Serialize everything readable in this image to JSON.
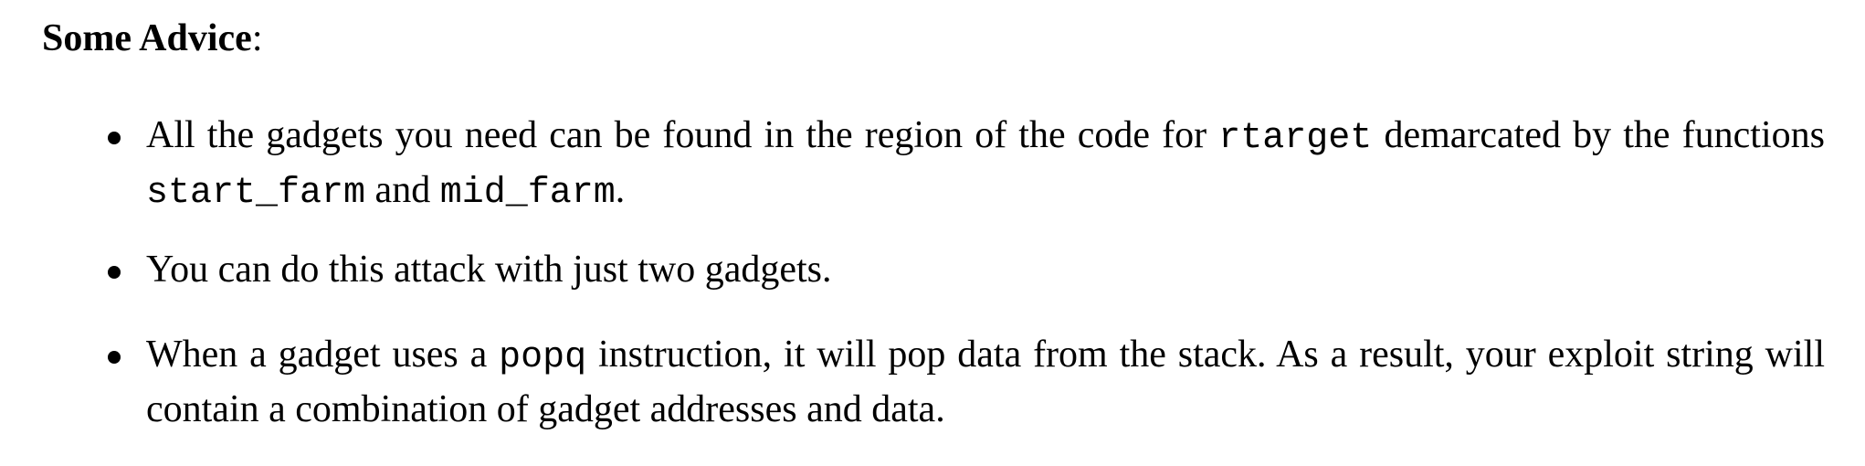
{
  "heading": {
    "bold_text": "Some Advice",
    "suffix": ":"
  },
  "items": [
    {
      "parts": [
        "All the gadgets you need can be found in the region of the code for ",
        "rtarget",
        " demarcated by the functions ",
        "start_farm",
        " and ",
        "mid_farm",
        "."
      ]
    },
    {
      "parts": [
        "You can do this attack with just two gadgets."
      ]
    },
    {
      "parts": [
        "When a gadget uses a ",
        "popq",
        " instruction, it will pop data from the stack.  As a result, your exploit string will contain a combination of gadget addresses and data."
      ]
    }
  ]
}
